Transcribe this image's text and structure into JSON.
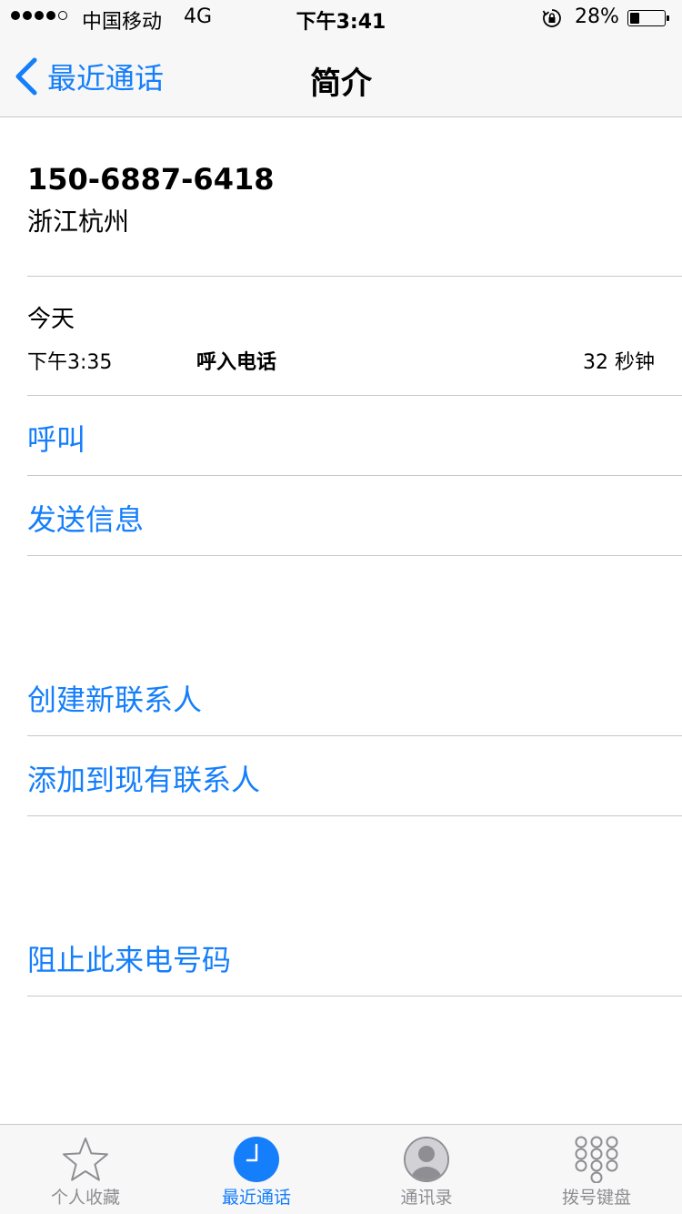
{
  "status_bar": {
    "carrier": "中国移动",
    "network": "4G",
    "time": "下午3:41",
    "battery_percent": "28%",
    "battery_level": 0.28,
    "signal_bars": 4,
    "signal_max": 5
  },
  "nav": {
    "back_label": "最近通话",
    "title": "简介"
  },
  "caller": {
    "number": "150-6887-6418",
    "location": "浙江杭州"
  },
  "call_log": {
    "date": "今天",
    "time": "下午3:35",
    "type": "呼入电话",
    "duration": "32 秒钟"
  },
  "actions": {
    "call": "呼叫",
    "send_message": "发送信息",
    "create_contact": "创建新联系人",
    "add_to_existing": "添加到现有联系人",
    "block": "阻止此来电号码"
  },
  "tabs": [
    {
      "label": "个人收藏",
      "icon": "star-icon",
      "active": false
    },
    {
      "label": "最近通话",
      "icon": "clock-icon",
      "active": true
    },
    {
      "label": "通讯录",
      "icon": "contacts-icon",
      "active": false
    },
    {
      "label": "拨号键盘",
      "icon": "keypad-icon",
      "active": false
    }
  ],
  "colors": {
    "accent": "#147efb",
    "bar_background": "#f7f7f7",
    "separator": "#c8c7cc",
    "inactive_tab": "#8e8e93"
  }
}
